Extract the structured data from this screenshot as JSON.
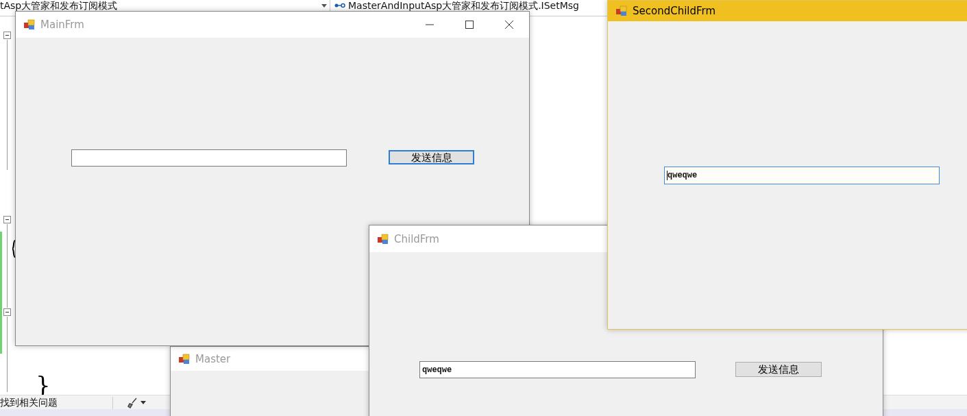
{
  "editor": {
    "nav_left": "tAsp大管家和发布订阅模式",
    "nav_right": "MasterAndInputAsp大管家和发布订阅模式.ISetMsg",
    "code_fragments": [
      "}"
    ]
  },
  "status_bar": {
    "text": "找到相关问题"
  },
  "windows": [
    {
      "title": "Master",
      "active": false,
      "caption_buttons": false
    },
    {
      "title": "MainFrm",
      "active": false,
      "caption_buttons": true,
      "textbox": {
        "focused": false
      },
      "button": {
        "label": "发送信息",
        "focused": true
      }
    },
    {
      "title": "ChildFrm",
      "active": false,
      "caption_buttons": false,
      "textbox": {
        "value": "qweqwe",
        "focused": false
      },
      "button": {
        "label": "发送信息",
        "focused": false
      }
    },
    {
      "title": "SecondChildFrm",
      "active": true,
      "caption_buttons": false,
      "textbox": {
        "value": "qweqwe",
        "focused": true
      }
    }
  ]
}
